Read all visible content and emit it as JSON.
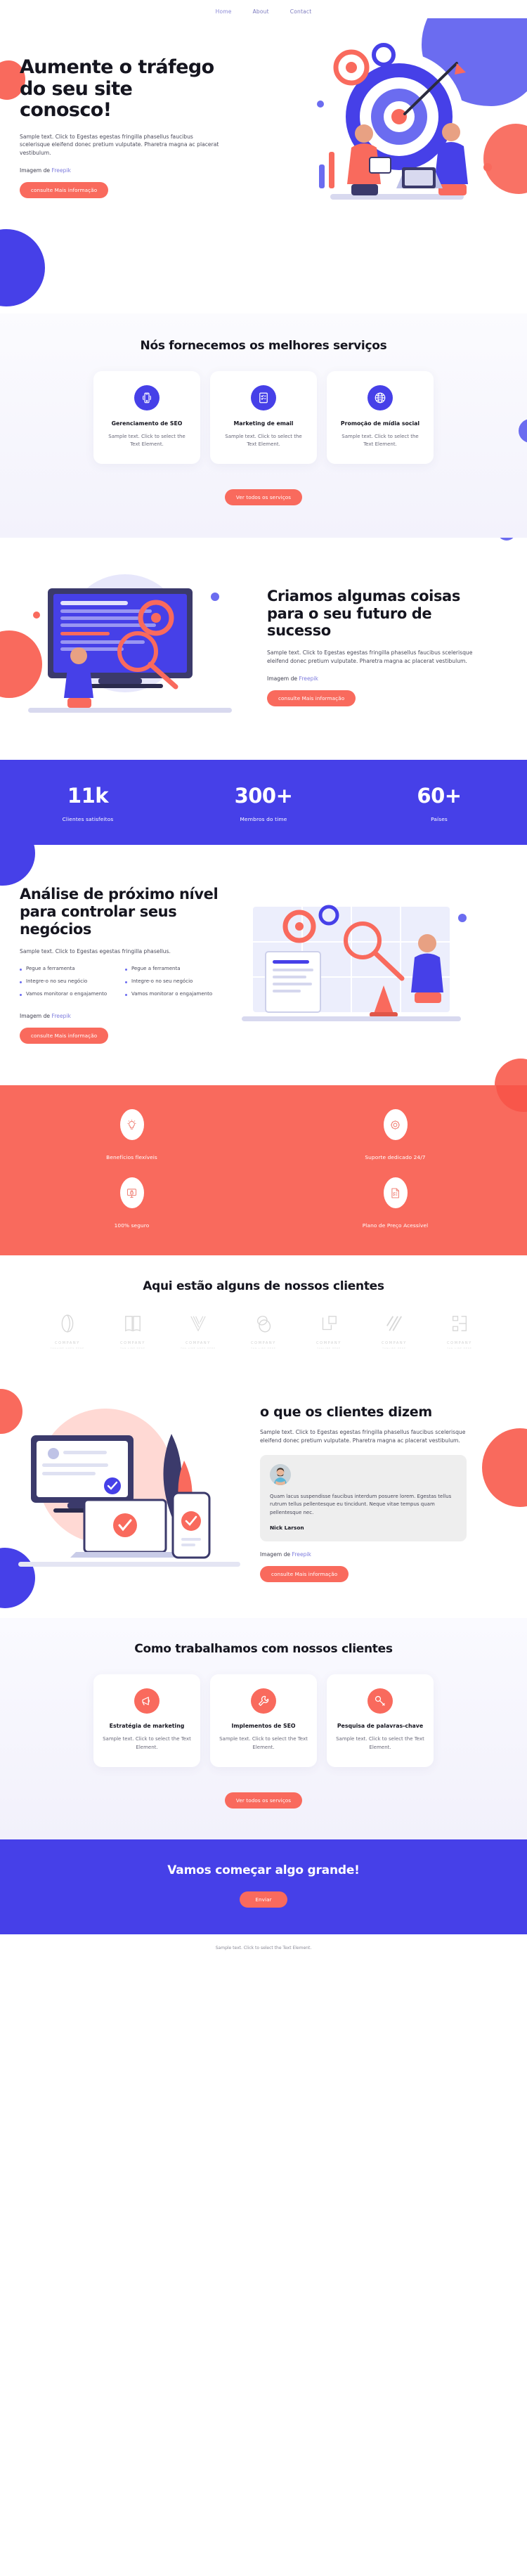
{
  "nav": {
    "items": [
      {
        "label": "Home",
        "active": true
      },
      {
        "label": "About",
        "active": false
      },
      {
        "label": "Contact",
        "active": false
      }
    ]
  },
  "hero": {
    "title": "Aumente o tráfego do seu site conosco!",
    "body": "Sample text. Click to Egestas egestas fringilla phasellus faucibus scelerisque eleifend donec pretium vulputate. Pharetra magna ac placerat vestibulum.",
    "credit_prefix": "Imagem de ",
    "credit_link": "Freepik",
    "cta": "consulte Mais informação"
  },
  "services": {
    "title": "Nós fornecemos os melhores serviços",
    "cards": [
      {
        "icon": "mobile-seo-icon",
        "title": "Gerenciamento de SEO",
        "body": "Sample text. Click to select the Text Element."
      },
      {
        "icon": "checklist-icon",
        "title": "Marketing de email",
        "body": "Sample text. Click to select the Text Element."
      },
      {
        "icon": "globe-icon",
        "title": "Promoção de mídia social",
        "body": "Sample text. Click to select the Text Element."
      }
    ],
    "cta": "Ver todos os serviços"
  },
  "feature": {
    "title": "Criamos algumas coisas para o seu futuro de sucesso",
    "body": "Sample text. Click to Egestas egestas fringilla phasellus faucibus scelerisque eleifend donec pretium vulputate. Pharetra magna ac placerat vestibulum.",
    "credit_prefix": "Imagem de ",
    "credit_link": "Freepik",
    "cta": "consulte Mais informação"
  },
  "stats": [
    {
      "num": "11k",
      "label": "Clientes satisfeitos"
    },
    {
      "num": "300+",
      "label": "Membros do time"
    },
    {
      "num": "60+",
      "label": "Países"
    }
  ],
  "analysis": {
    "title": "Análise de próximo nível para controlar seus negócios",
    "body": "Sample text. Click to Egestas egestas fringilla phasellus.",
    "list_left": [
      "Pegue a ferramenta",
      "Integre-o no seu negócio",
      "Vamos monitorar o engajamento"
    ],
    "list_right": [
      "Pegue a ferramenta",
      "Integre-o no seu negócio",
      "Vamos monitorar o engajamento"
    ],
    "credit_prefix": "Imagem de ",
    "credit_link": "Freepik",
    "cta": "consulte Mais informação"
  },
  "benefits": [
    {
      "icon": "lightbulb-icon",
      "label": "Benefícios flexíveis"
    },
    {
      "icon": "gear-icon",
      "label": "Suporte dedicado 24/7"
    },
    {
      "icon": "lock-screen-icon",
      "label": "100% seguro"
    },
    {
      "icon": "document-list-icon",
      "label": "Plano de Preço Acessível"
    }
  ],
  "clients": {
    "title": "Aqui estão alguns de nossos clientes",
    "logos": [
      {
        "icon": "logo-ring-icon",
        "name": "COMPANY",
        "tagline": "TAGLINE GOES HERE"
      },
      {
        "icon": "logo-book-icon",
        "name": "COMPANY",
        "tagline": "TAG LINE HERE"
      },
      {
        "icon": "logo-vlines-icon",
        "name": "COMPANY",
        "tagline": "TAG LINE GOES HERE"
      },
      {
        "icon": "logo-ovals-icon",
        "name": "COMPANY",
        "tagline": "TAG LINE HERE"
      },
      {
        "icon": "logo-squares-icon",
        "name": "COMPANY",
        "tagline": "TAGLINE HERE"
      },
      {
        "icon": "logo-slashes-icon",
        "name": "COMPANY",
        "tagline": "TAGLINE HERE"
      },
      {
        "icon": "logo-brackets-icon",
        "name": "COMPANY",
        "tagline": "TAG LINE HERE"
      }
    ]
  },
  "testimonial": {
    "title": "o que os clientes dizem",
    "body": "Sample text. Click to Egestas egestas fringilla phasellus faucibus scelerisque eleifend donec pretium vulputate. Pharetra magna ac placerat vestibulum.",
    "quote": "Quam lacus suspendisse faucibus interdum posuere lorem. Egestas tellus rutrum tellus pellentesque eu tincidunt. Neque vitae tempus quam pellentesque nec.",
    "author": "Nick Larson",
    "credit_prefix": "Imagem de ",
    "credit_link": "Freepik",
    "cta": "consulte Mais informação"
  },
  "process": {
    "title": "Como trabalhamos com nossos clientes",
    "cards": [
      {
        "icon": "megaphone-icon",
        "title": "Estratégia de marketing",
        "body": "Sample text. Click to select the Text Element."
      },
      {
        "icon": "wrench-icon",
        "title": "Implementos de SEO",
        "body": "Sample text. Click to select the Text Element."
      },
      {
        "icon": "key-icon",
        "title": "Pesquisa de palavras-chave",
        "body": "Sample text. Click to select the Text Element."
      }
    ],
    "cta": "Ver todos os serviços"
  },
  "cta": {
    "title": "Vamos começar algo grande!",
    "button": "Enviar"
  },
  "footer": {
    "text": "Sample text. Click to select the Text Element."
  },
  "colors": {
    "blue": "#4640e8",
    "red": "#f96a5d",
    "light_blue": "#6b6cf0",
    "dark": "#15151f"
  }
}
